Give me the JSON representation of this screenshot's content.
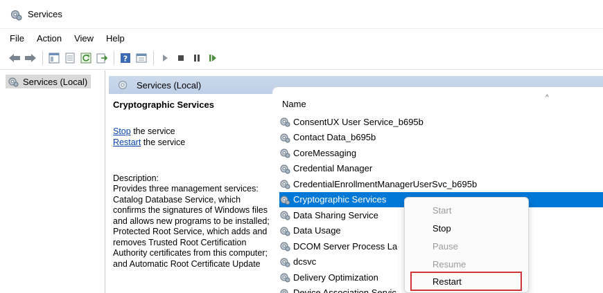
{
  "window": {
    "title": "Services"
  },
  "menubar": {
    "items": [
      "File",
      "Action",
      "View",
      "Help"
    ]
  },
  "toolbar": {
    "buttons": [
      "back-icon",
      "forward-icon",
      "show-hide-tree-icon",
      "properties-icon",
      "refresh-icon",
      "export-list-icon",
      "help-icon",
      "view-icon",
      "start-icon",
      "stop-icon",
      "pause-icon",
      "resume-icon"
    ]
  },
  "tree": {
    "root": "Services (Local)"
  },
  "pane": {
    "header": "Services (Local)",
    "details": {
      "service_name": "Cryptographic Services",
      "stop_link": "Stop",
      "stop_suffix": " the service",
      "restart_link": "Restart",
      "restart_suffix": " the service",
      "description_label": "Description:",
      "description_text": "Provides three management services: Catalog Database Service, which confirms the signatures of Windows files and allows new programs to be installed; Protected Root Service, which adds and removes Trusted Root Certification Authority certificates from this computer; and Automatic Root Certificate Update"
    },
    "list": {
      "column_name": "Name",
      "rows": [
        "ConsentUX User Service_b695b",
        "Contact Data_b695b",
        "CoreMessaging",
        "Credential Manager",
        "CredentialEnrollmentManagerUserSvc_b695b",
        "Cryptographic Services",
        "Data Sharing Service",
        "Data Usage",
        "DCOM Server Process La",
        "dcsvc",
        "Delivery Optimization",
        "Device Association Servic"
      ],
      "selected_index": 5
    }
  },
  "context_menu": {
    "items": [
      {
        "label": "Start",
        "enabled": false
      },
      {
        "label": "Stop",
        "enabled": true
      },
      {
        "label": "Pause",
        "enabled": false
      },
      {
        "label": "Resume",
        "enabled": false
      },
      {
        "label": "Restart",
        "enabled": true,
        "highlighted": true
      }
    ]
  },
  "colors": {
    "selection": "#0078d7",
    "header": "#c7d6ea",
    "link": "#0645ad",
    "highlight_border": "#d13438"
  }
}
